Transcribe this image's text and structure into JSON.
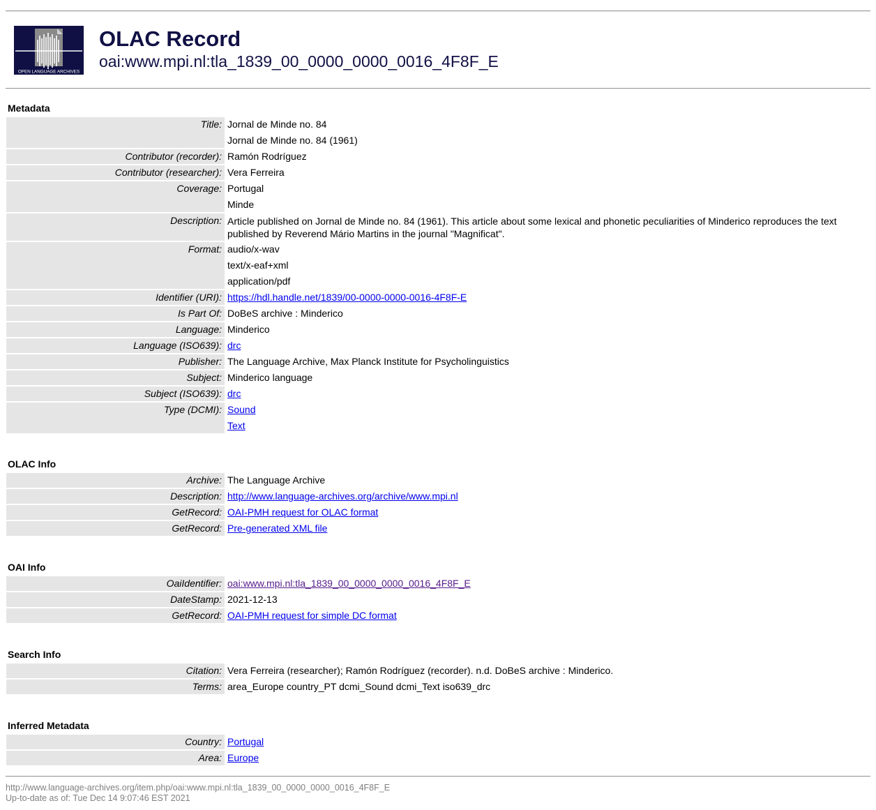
{
  "header": {
    "logo_text": "OPEN LANGUAGE ARCHIVES",
    "title": "OLAC Record",
    "identifier": "oai:www.mpi.nl:tla_1839_00_0000_0000_0016_4F8F_E"
  },
  "metadata": {
    "heading": "Metadata",
    "rows": [
      {
        "label": "Title:",
        "values": [
          "Jornal de Minde no. 84",
          "Jornal de Minde no. 84 (1961)"
        ]
      },
      {
        "label": "Contributor (recorder):",
        "values": [
          "Ramón Rodríguez"
        ]
      },
      {
        "label": "Contributor (researcher):",
        "values": [
          "Vera Ferreira"
        ]
      },
      {
        "label": "Coverage:",
        "values": [
          "Portugal",
          "Minde"
        ]
      },
      {
        "label": "Description:",
        "values": [
          "Article published on Jornal de Minde no. 84 (1961). This article about some lexical and phonetic peculiarities of Minderico reproduces the text published by Reverend Mário Martins in the journal \"Magnificat\"."
        ]
      },
      {
        "label": "Format:",
        "values": [
          "audio/x-wav",
          "text/x-eaf+xml",
          "application/pdf"
        ]
      },
      {
        "label": "Identifier (URI):",
        "values": [
          "https://hdl.handle.net/1839/00-0000-0000-0016-4F8F-E"
        ]
      },
      {
        "label": "Is Part Of:",
        "values": [
          "DoBeS archive : Minderico"
        ]
      },
      {
        "label": "Language:",
        "values": [
          "Minderico"
        ]
      },
      {
        "label": "Language (ISO639):",
        "values": [
          "drc"
        ]
      },
      {
        "label": "Publisher:",
        "values": [
          "The Language Archive, Max Planck Institute for Psycholinguistics"
        ]
      },
      {
        "label": "Subject:",
        "values": [
          "Minderico language"
        ]
      },
      {
        "label": "Subject (ISO639):",
        "values": [
          "drc"
        ]
      },
      {
        "label": "Type (DCMI):",
        "values": [
          "Sound",
          "Text"
        ]
      }
    ]
  },
  "olac_info": {
    "heading": "OLAC Info",
    "rows": [
      {
        "label": "Archive:",
        "value": "The Language Archive"
      },
      {
        "label": "Description:",
        "value": "http://www.language-archives.org/archive/www.mpi.nl"
      },
      {
        "label": "GetRecord:",
        "value": "OAI-PMH request for OLAC format"
      },
      {
        "label": "GetRecord:",
        "value": "Pre-generated XML file"
      }
    ]
  },
  "oai_info": {
    "heading": "OAI Info",
    "rows": [
      {
        "label": "OaiIdentifier:",
        "value": "oai:www.mpi.nl:tla_1839_00_0000_0000_0016_4F8F_E"
      },
      {
        "label": "DateStamp:",
        "value": "2021-12-13"
      },
      {
        "label": "GetRecord:",
        "value": "OAI-PMH request for simple DC format"
      }
    ]
  },
  "search_info": {
    "heading": "Search Info",
    "rows": [
      {
        "label": "Citation:",
        "value": "Vera Ferreira (researcher); Ramón Rodríguez (recorder). n.d. DoBeS archive : Minderico."
      },
      {
        "label": "Terms:",
        "value": "area_Europe country_PT dcmi_Sound dcmi_Text iso639_drc"
      }
    ]
  },
  "inferred": {
    "heading": "Inferred Metadata",
    "rows": [
      {
        "label": "Country:",
        "value": "Portugal"
      },
      {
        "label": "Area:",
        "value": "Europe"
      }
    ]
  },
  "footer": {
    "url": "http://www.language-archives.org/item.php/oai:www.mpi.nl:tla_1839_00_0000_0000_0016_4F8F_E",
    "updated": "Up-to-date as of: Tue Dec 14 9:07:46 EST 2021"
  },
  "colors": {
    "title": "#101045",
    "label_bg": "#e5e5e5",
    "link": "#0000ee",
    "visited_link": "#551a8b",
    "footer_text": "#808080"
  }
}
